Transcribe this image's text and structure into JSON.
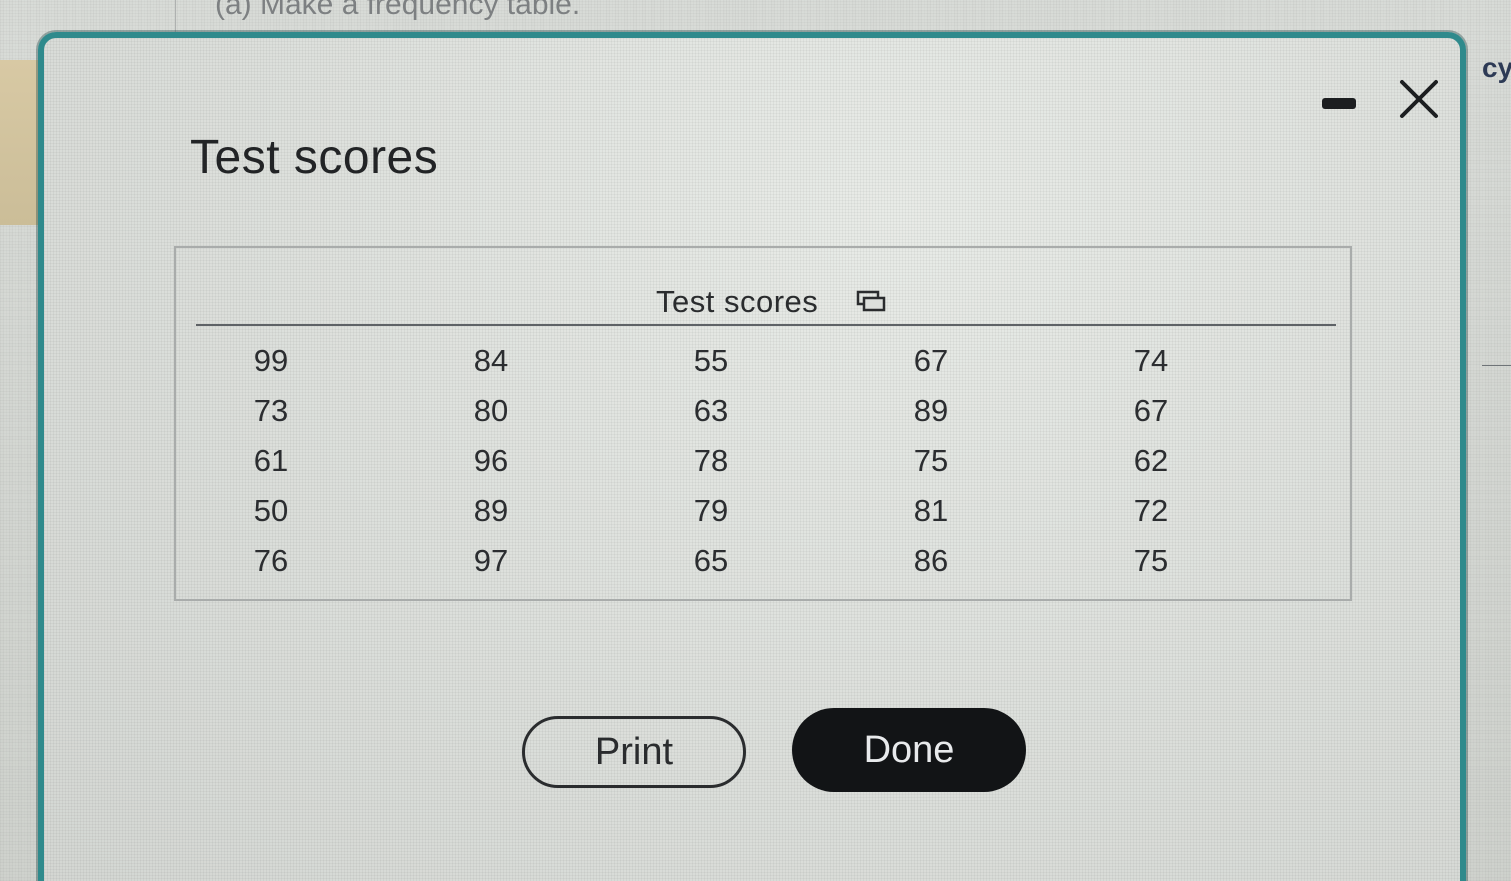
{
  "background": {
    "instruction_text": "(a) Make a frequency table.",
    "right_edge_text": "cy"
  },
  "modal": {
    "title": "Test scores",
    "minimize_label": "minimize",
    "close_label": "close",
    "accent_color": "#2f8a8c"
  },
  "table": {
    "header": "Test scores",
    "rows": [
      [
        "99",
        "84",
        "55",
        "67",
        "74"
      ],
      [
        "73",
        "80",
        "63",
        "89",
        "67"
      ],
      [
        "61",
        "96",
        "78",
        "75",
        "62"
      ],
      [
        "50",
        "89",
        "79",
        "81",
        "72"
      ],
      [
        "76",
        "97",
        "65",
        "86",
        "75"
      ]
    ]
  },
  "buttons": {
    "print_label": "Print",
    "done_label": "Done"
  },
  "icons": {
    "copy": "copy-icon",
    "minimize": "minimize-icon",
    "close": "close-icon"
  }
}
